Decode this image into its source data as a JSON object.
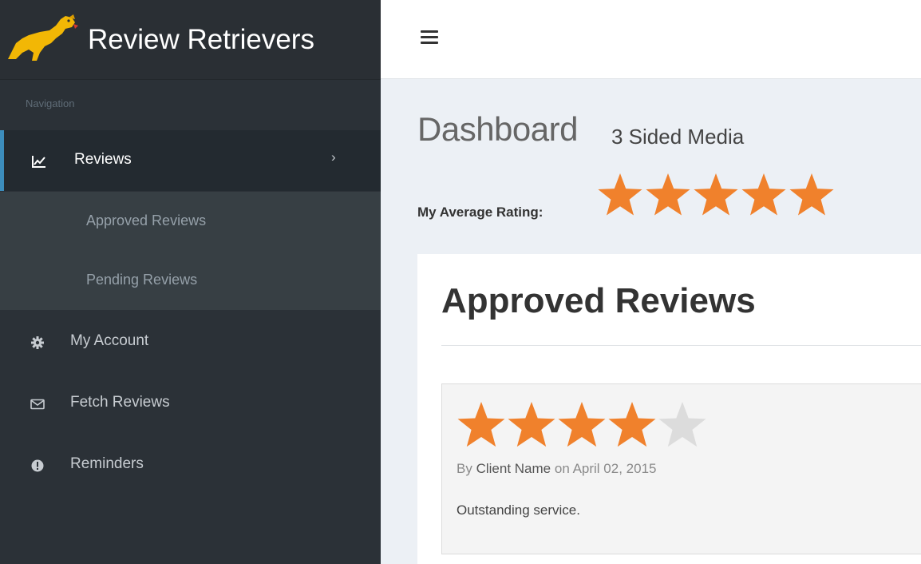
{
  "brand": {
    "title": "Review Retrievers",
    "logo_icon": "retriever-dog-logo"
  },
  "sidebar": {
    "header": "Navigation",
    "items": [
      {
        "label": "Reviews",
        "icon": "line-chart-icon",
        "active": true
      },
      {
        "label": "My Account",
        "icon": "gear-icon"
      },
      {
        "label": "Fetch Reviews",
        "icon": "envelope-icon"
      },
      {
        "label": "Reminders",
        "icon": "exclamation-circle-icon"
      }
    ],
    "subitems": [
      {
        "label": "Approved Reviews"
      },
      {
        "label": "Pending Reviews"
      }
    ]
  },
  "topbar": {
    "menu_icon": "hamburger-icon"
  },
  "page": {
    "title": "Dashboard",
    "subtitle": "3 Sided Media",
    "average_rating_label": "My Average Rating:",
    "average_rating": 5,
    "max_rating": 5
  },
  "box": {
    "title": "Approved Reviews",
    "reviews": [
      {
        "rating": 4,
        "max_rating": 5,
        "by_prefix": "By",
        "client": "Client Name",
        "on_prefix": "on",
        "date": "April 02, 2015",
        "text": "Outstanding service."
      }
    ]
  },
  "colors": {
    "star_filled": "#f0812c",
    "star_empty": "#dcdcdc",
    "sidebar_bg": "#2b3137",
    "active_accent": "#3c8dbc"
  }
}
